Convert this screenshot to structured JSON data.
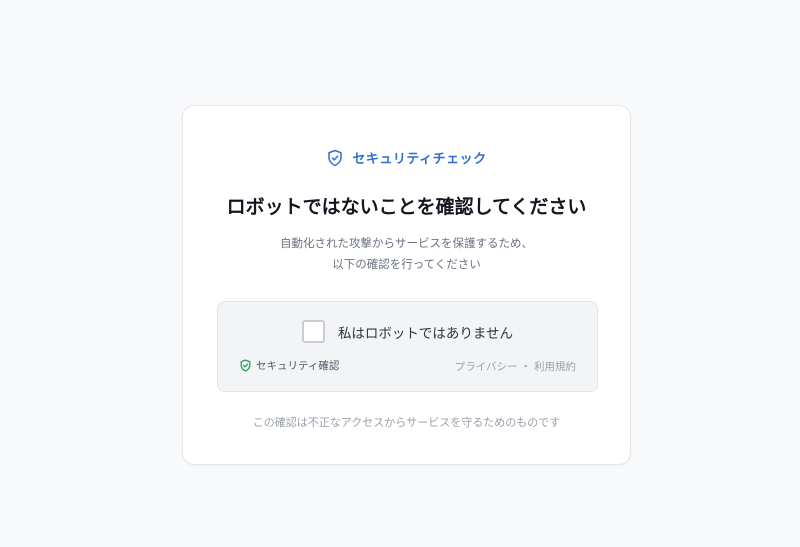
{
  "header": {
    "icon": "shield-check-icon",
    "label": "セキュリティチェック",
    "accent_color": "#2f6fd0"
  },
  "title": "ロボットではないことを確認してください",
  "description": {
    "line1": "自動化された攻撃からサービスを保護するため、",
    "line2": "以下の確認を行ってください"
  },
  "captcha": {
    "checkbox_checked": false,
    "checkbox_label": "私はロボットではありません",
    "badge_icon": "shield-check-icon",
    "badge_label": "セキュリティ確認",
    "badge_color": "#22a05b",
    "privacy_link": "プライバシー",
    "separator": "・",
    "terms_link": "利用規約"
  },
  "footer": "この確認は不正なアクセスからサービスを守るためのものです"
}
